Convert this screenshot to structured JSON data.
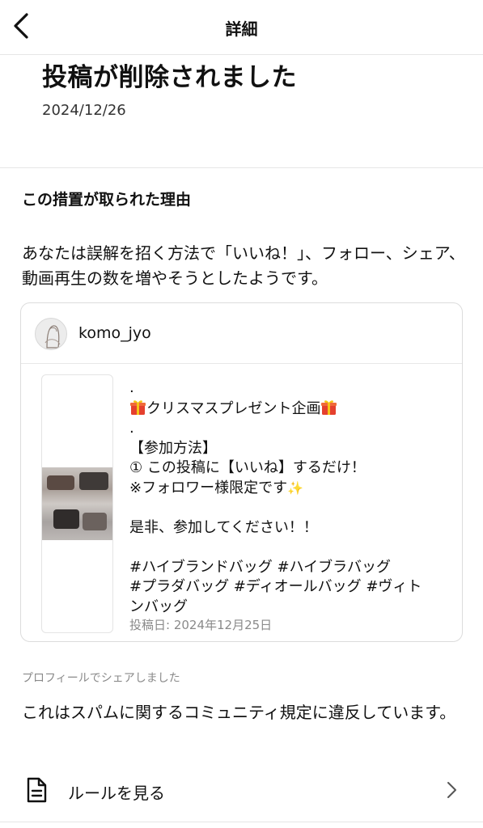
{
  "header": {
    "title": "詳細",
    "back_icon": "chevron-left-icon"
  },
  "removal": {
    "title": "投稿が削除されました",
    "date": "2024/12/26"
  },
  "reason": {
    "heading": "この措置が取られた理由",
    "text": "あなたは誤解を招く方法で「いいね！」、フォロー、シェア、動画再生の数を増やそうとしたようです。"
  },
  "post": {
    "username": "komo_jyo",
    "caption_lines": [
      ".",
      "クリスマスプレゼント企画",
      ".",
      "【参加方法】",
      "① この投稿に【いいね】するだけ！",
      "※フォロワー様限定です",
      "",
      "是非、参加してください！！",
      "",
      "#ハイブランドバッグ #ハイブラバッグ",
      "#プラダバッグ #ディオールバッグ #ヴィト",
      "ンバッグ"
    ],
    "posted_date": "投稿日: 2024年12月25日"
  },
  "shared_note": "プロフィールでシェアしました",
  "violation_text": "これはスパムに関するコミュニティ規定に違反しています。",
  "rules": {
    "label": "ルールを見る",
    "icon": "document-icon",
    "chevron": "chevron-right-icon"
  }
}
